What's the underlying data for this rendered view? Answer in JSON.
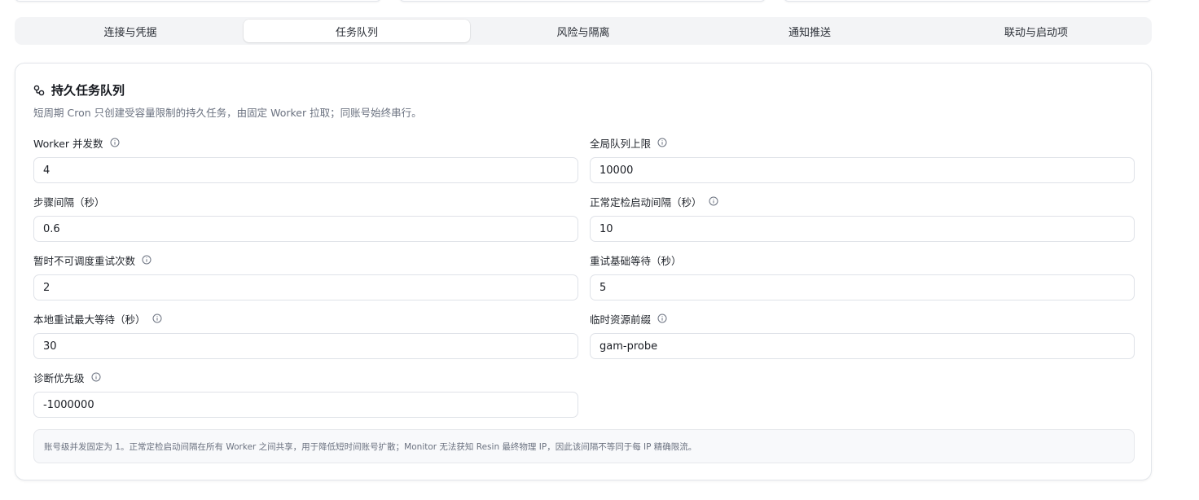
{
  "tabs": [
    {
      "label": "连接与凭据",
      "active": false
    },
    {
      "label": "任务队列",
      "active": true
    },
    {
      "label": "风险与隔离",
      "active": false
    },
    {
      "label": "通知推送",
      "active": false
    },
    {
      "label": "联动与启动项",
      "active": false
    }
  ],
  "section": {
    "icon": "link-icon",
    "title": "持久任务队列",
    "description": "短周期 Cron 只创建受容量限制的持久任务，由固定 Worker 拉取；同账号始终串行。"
  },
  "fields": {
    "worker_concurrency": {
      "label": "Worker 并发数",
      "value": "4",
      "has_info": true
    },
    "global_queue_limit": {
      "label": "全局队列上限",
      "value": "10000",
      "has_info": true
    },
    "step_interval": {
      "label": "步骤间隔（秒）",
      "value": "0.6",
      "has_info": false
    },
    "scheduled_check_interval": {
      "label": "正常定检启动间隔（秒）",
      "value": "10",
      "has_info": true
    },
    "unschedulable_retries": {
      "label": "暂时不可调度重试次数",
      "value": "2",
      "has_info": true
    },
    "retry_base_wait": {
      "label": "重试基础等待（秒）",
      "value": "5",
      "has_info": false
    },
    "local_retry_max_wait": {
      "label": "本地重试最大等待（秒）",
      "value": "30",
      "has_info": true
    },
    "temp_resource_prefix": {
      "label": "临时资源前缀",
      "value": "gam-probe",
      "has_info": true
    },
    "diagnostic_priority": {
      "label": "诊断优先级",
      "value": "-1000000",
      "has_info": true
    }
  },
  "note": "账号级并发固定为 1。正常定检启动间隔在所有 Worker 之间共享，用于降低短时间账号扩散；Monitor 无法获知 Resin 最终物理 IP，因此该间隔不等同于每 IP 精确限流。"
}
